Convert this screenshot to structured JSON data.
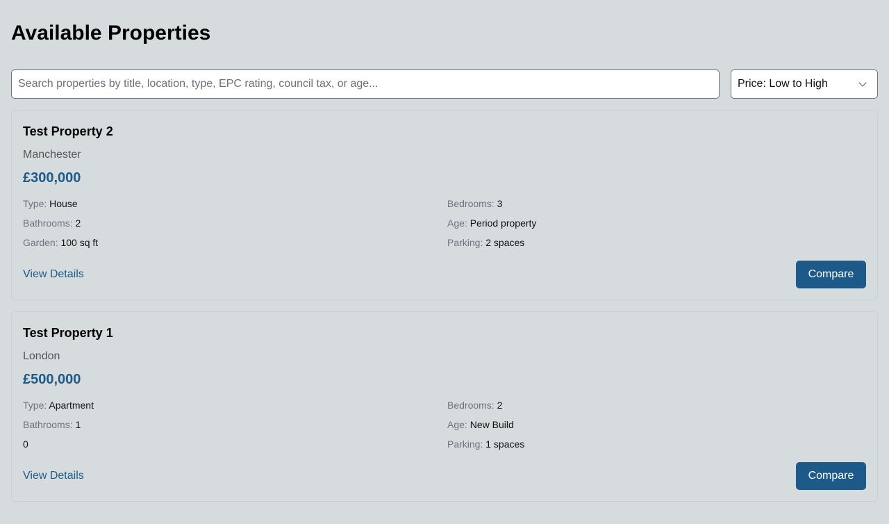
{
  "page_title": "Available Properties",
  "search": {
    "placeholder": "Search properties by title, location, type, EPC rating, council tax, or age...",
    "value": ""
  },
  "sort": {
    "selected": "Price: Low to High"
  },
  "properties": [
    {
      "title": "Test Property 2",
      "location": "Manchester",
      "price": "£300,000",
      "type_label": "Type:",
      "type": "House",
      "bedrooms_label": "Bedrooms:",
      "bedrooms": "3",
      "bathrooms_label": "Bathrooms:",
      "bathrooms": "2",
      "age_label": "Age:",
      "age": "Period property",
      "garden_label": "Garden:",
      "garden": "100 sq ft",
      "parking_label": "Parking:",
      "parking": "2 spaces",
      "view_label": "View Details",
      "compare_label": "Compare"
    },
    {
      "title": "Test Property 1",
      "location": "London",
      "price": "£500,000",
      "type_label": "Type:",
      "type": "Apartment",
      "bedrooms_label": "Bedrooms:",
      "bedrooms": "2",
      "bathrooms_label": "Bathrooms:",
      "bathrooms": "1",
      "age_label": "Age:",
      "age": "New Build",
      "garden_label": "",
      "garden": "0",
      "parking_label": "Parking:",
      "parking": "1 spaces",
      "view_label": "View Details",
      "compare_label": "Compare"
    }
  ]
}
